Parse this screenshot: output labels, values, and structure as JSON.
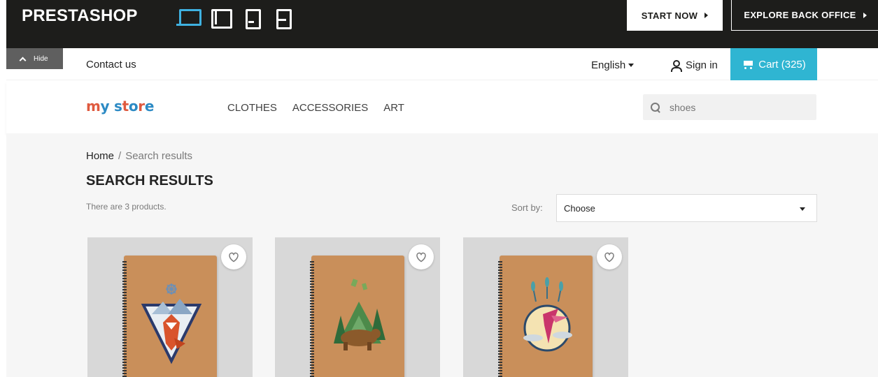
{
  "demo_bar": {
    "brand": "PRESTASHOP",
    "devices": [
      "desktop-icon",
      "laptop-icon",
      "phone-icon",
      "tablet-icon"
    ],
    "start_now": "START NOW",
    "explore": "EXPLORE BACK OFFICE",
    "hide": "Hide"
  },
  "nav": {
    "contact": "Contact us",
    "language": "English",
    "sign_in": "Sign in",
    "cart": "Cart (325)"
  },
  "header": {
    "logo": {
      "letters": [
        "m",
        "y",
        " ",
        "s",
        "t",
        "o",
        "r",
        "e"
      ],
      "colors": [
        "#df5a3f",
        "#2c8ac4",
        "#ffffff",
        "#2c8ac4",
        "#df5a3f",
        "#2c8ac4",
        "#df5a3f",
        "#2c8ac4"
      ]
    },
    "menu": [
      "CLOTHES",
      "ACCESSORIES",
      "ART"
    ],
    "search": {
      "value": "",
      "placeholder": "shoes"
    }
  },
  "breadcrumb": {
    "home": "Home",
    "separator": "/",
    "current": "Search results"
  },
  "page": {
    "title": "SEARCH RESULTS",
    "count": "There are 3 products.",
    "sort_label": "Sort by:",
    "sort_value": "Choose"
  },
  "products": [
    {
      "art": "fox-triangle",
      "wishlist_icon": "heart-icon"
    },
    {
      "art": "bear-forest",
      "wishlist_icon": "heart-icon"
    },
    {
      "art": "hummingbird-circle",
      "wishlist_icon": "heart-icon"
    }
  ],
  "colors": {
    "accent": "#2fb5d2",
    "demo_bar": "#1d1d1b",
    "hide_tab": "#5f5f5f",
    "card_bg": "#d8d8d8",
    "notebook": "#c98f5a"
  }
}
